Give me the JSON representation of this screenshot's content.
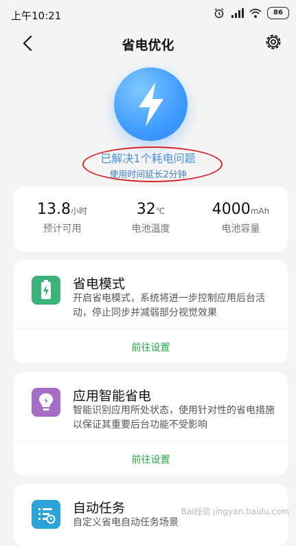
{
  "status_bar": {
    "time": "上午10:21",
    "battery": "86"
  },
  "header": {
    "title": "省电优化"
  },
  "hero": {
    "resolved": "已解决1个耗电问题",
    "extended": "使用时间延长2分钟"
  },
  "stats": [
    {
      "value": "13.8",
      "unit": "小时",
      "label": "预计可用"
    },
    {
      "value": "32",
      "unit": "℃",
      "label": "电池温度"
    },
    {
      "value": "4000",
      "unit": "mAh",
      "label": "电池容量"
    }
  ],
  "features": [
    {
      "title": "省电模式",
      "desc": "开启省电模式，系统将进一步控制应用后台活动，停止同步并减弱部分视觉效果",
      "action": "前往设置",
      "icon": "battery-icon",
      "color": "#3bb27a"
    },
    {
      "title": "应用智能省电",
      "desc": "智能识别应用所处状态，使用针对性的省电措施以保证其重要后台功能不受影响",
      "action": "前往设置",
      "icon": "lightbulb-icon",
      "color": "#a46ec4"
    },
    {
      "title": "自动任务",
      "desc": "自定义省电自动任务场景",
      "icon": "task-list-icon",
      "color": "#2ba3d8"
    }
  ],
  "watermark": "Bai经验 jingyan.baidu.com"
}
